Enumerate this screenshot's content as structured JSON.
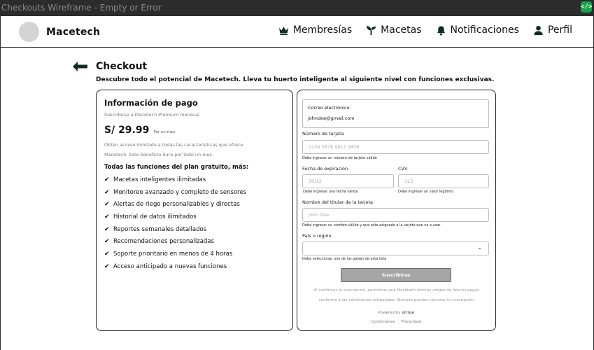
{
  "window": {
    "title": "Checkouts Wireframe - Empty or Error",
    "code_icon": "code-icon"
  },
  "header": {
    "brand": "Macetech",
    "nav": [
      {
        "label": "Membresías",
        "icon": "crown-icon"
      },
      {
        "label": "Macetas",
        "icon": "sprout-icon"
      },
      {
        "label": "Notificaciones",
        "icon": "bell-icon"
      },
      {
        "label": "Perfil",
        "icon": "user-icon"
      }
    ]
  },
  "page": {
    "title": "Checkout",
    "subtitle": "Descubre todo el potencial de Macetech. Lleva tu huerto inteligente al siguiente nivel con funciones exclusivas."
  },
  "payment_info": {
    "title": "Información de pago",
    "subtitle": "Suscribirse a Macetech Premium mensual",
    "price": "S/ 29.99",
    "period": "Por un mes",
    "description_line1": "Obtén acceso ilimitado a todas las características que ofrece",
    "description_line2": "Macetech. Este beneficio dura por todo un mes.",
    "features_title": "Todas las funciones del plan gratuito, más:",
    "check_symbol": "✔",
    "features": [
      "Macetas inteligentes ilimitadas",
      "Monitoreo avanzado y completo de sensores",
      "Alertas de riego personalizables y directas",
      "Historial de datos ilimitados",
      "Reportes semanales detallados",
      "Recomendaciones personalizadas",
      "Soporte prioritario en menos de 4 horas",
      "Acceso anticipado a nuevas funciones"
    ]
  },
  "form": {
    "email_label": "Correo electrónico",
    "email_value": "johndoe@gmail.com",
    "card_number_label": "Número de tarjeta",
    "card_number_placeholder": "1234 5678 9012 3456",
    "card_number_error": "Debe ingresar un número de tarjeta válido",
    "expiry_label": "Fecha de expiración",
    "expiry_placeholder": "30/12",
    "expiry_error": "Debe ingresar una fecha válida",
    "cvv_label": "CVV",
    "cvv_placeholder": "123",
    "cvv_error": "Debe ingresar un valor legítimo",
    "holder_label": "Nombre del titular de la tarjeta",
    "holder_placeholder": "John Doe",
    "holder_error": "Debe ingresar un nombre válido y que este asignado a la tarjeta que va a usar",
    "country_label": "País o región",
    "country_error": "Debe seleccionar uno de los paises de esta lista",
    "subscribe_label": "Suscribirse",
    "consent_line1": "Al confirmar tu suscripción, permitirás que Macetech efectúe cargos de futuros pagos",
    "consent_line2": "conforme a las condiciones estipuladas. Siempre puedes cancelar tu suscripción",
    "powered_by": "Powered by",
    "stripe": "stripe",
    "terms": "Condiciones",
    "privacy": "Privacidad"
  },
  "colors": {
    "nav_icon": "#0f2d1f",
    "button": "#a6a6a6"
  }
}
